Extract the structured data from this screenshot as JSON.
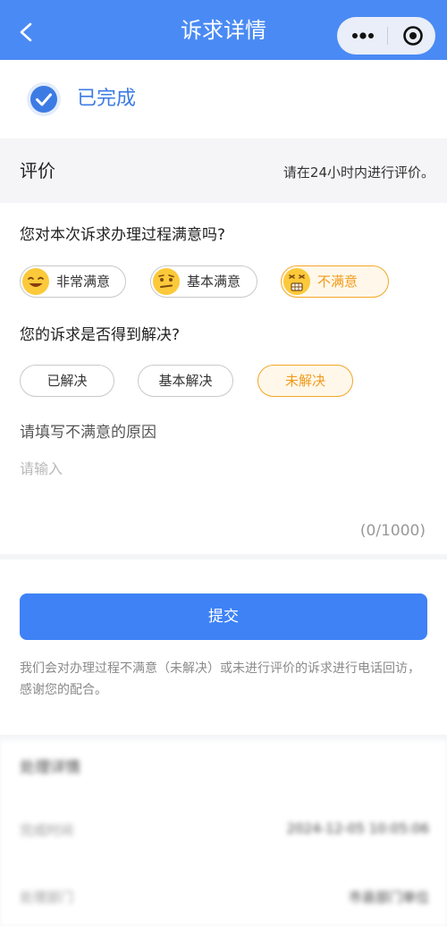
{
  "nav": {
    "title": "诉求详情"
  },
  "status": {
    "text": "已完成"
  },
  "evaluation": {
    "title": "评价",
    "hint": "请在24小时内进行评价。",
    "satisfaction_question": "您对本次诉求办理过程满意吗?",
    "satisfaction_options": [
      "非常满意",
      "基本满意",
      "不满意"
    ],
    "satisfaction_selected": "不满意",
    "resolution_question": "您的诉求是否得到解决?",
    "resolution_options": [
      "已解决",
      "基本解决",
      "未解决"
    ],
    "resolution_selected": "未解决",
    "reason_label": "请填写不满意的原因",
    "reason_placeholder": "请输入",
    "reason_value": "",
    "counter": "(0/1000)"
  },
  "submit": {
    "label": "提交",
    "note": "我们会对办理过程不满意（未解决）或未进行评价的诉求进行电话回访，感谢您的配合。"
  },
  "detail": {
    "title": "处理详情",
    "rows": [
      {
        "label": "完成时间",
        "value": "2024-12-05 10:05:06"
      },
      {
        "label": "处理部门",
        "value": "市县部门单位"
      }
    ]
  },
  "colors": {
    "nav_bg": "#4a8af4",
    "accent": "#3e82f6",
    "warning": "#f19a1b"
  }
}
